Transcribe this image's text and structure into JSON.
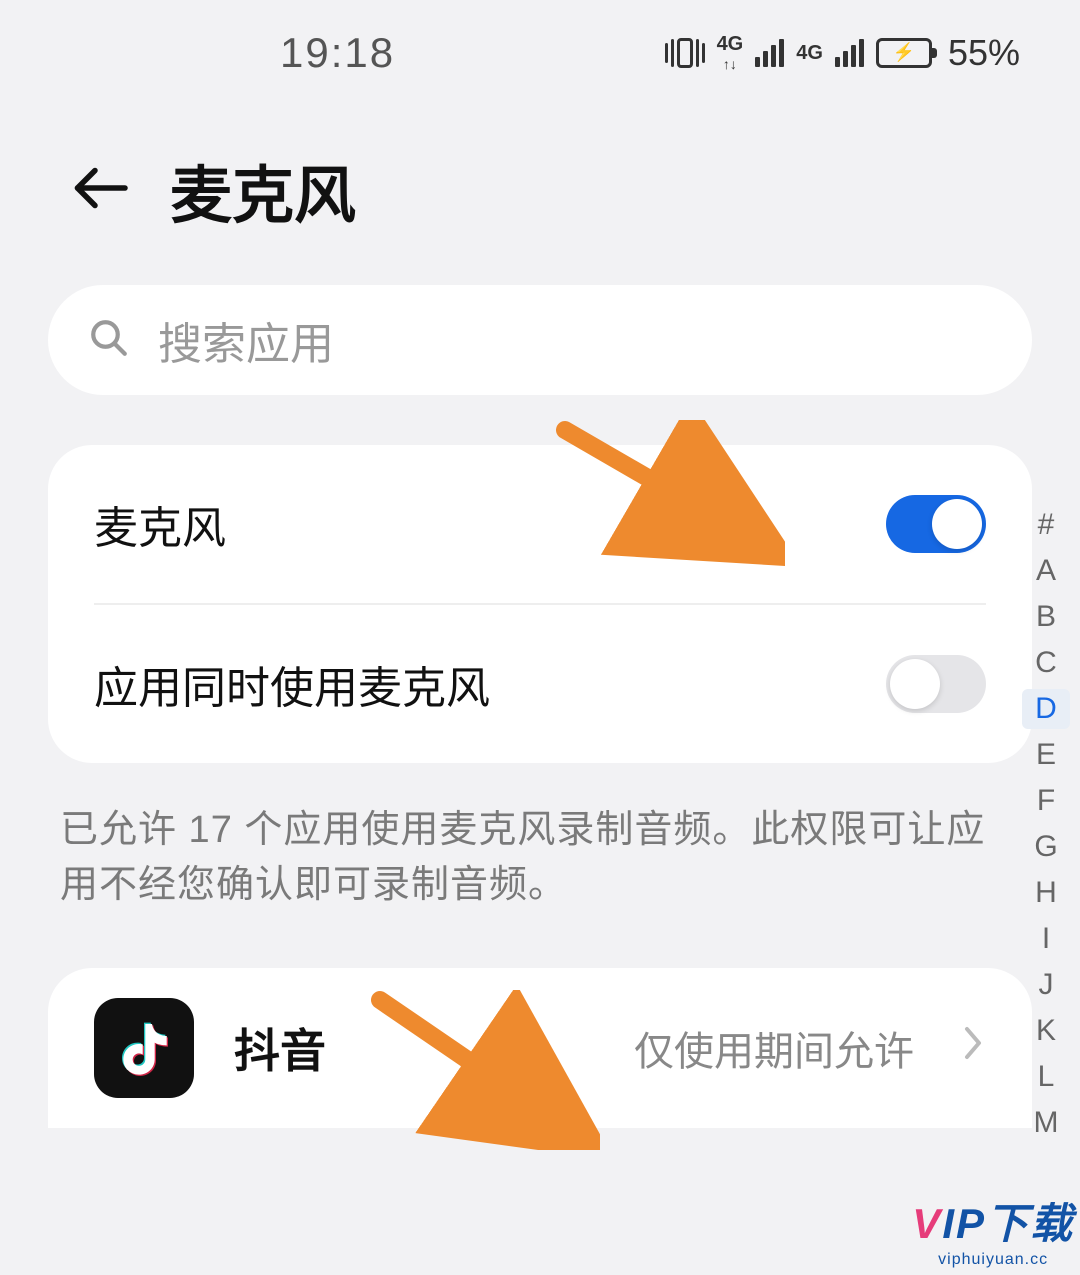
{
  "status": {
    "time": "19:18",
    "sig1_label": "4G",
    "sig2_label": "4G",
    "battery_pct": "55%"
  },
  "header": {
    "title": "麦克风"
  },
  "search": {
    "placeholder": "搜索应用"
  },
  "toggles": {
    "mic_label": "麦克风",
    "mic_on": true,
    "multi_label": "应用同时使用麦克风",
    "multi_on": false
  },
  "description": "已允许 17 个应用使用麦克风录制音频。此权限可让应用不经您确认即可录制音频。",
  "app": {
    "name": "抖音",
    "status": "仅使用期间允许"
  },
  "index": {
    "letters": [
      "#",
      "A",
      "B",
      "C",
      "D",
      "E",
      "F",
      "G",
      "H",
      "I",
      "J",
      "K",
      "L",
      "M"
    ],
    "active": "D"
  },
  "watermark": {
    "brand_v": "V",
    "brand_rest": "IP下载",
    "subtitle": "viphuiyuan.cc"
  }
}
